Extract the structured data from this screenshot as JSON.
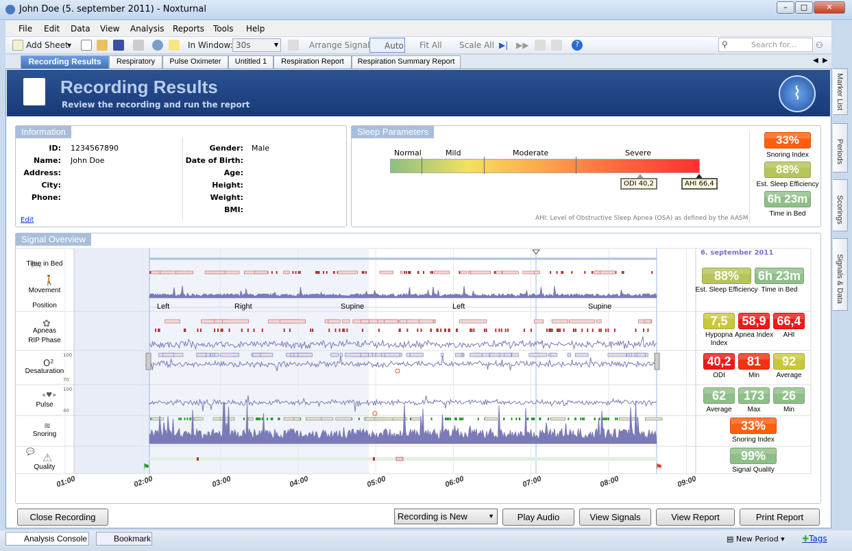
{
  "window": {
    "title": "John Doe (5. september 2011)  - Noxturnal"
  },
  "menu": [
    "File",
    "Edit",
    "Data",
    "View",
    "Analysis",
    "Reports",
    "Tools",
    "Help"
  ],
  "toolbar": {
    "add_sheet": "Add Sheet",
    "in_window_label": "In Window:",
    "in_window_value": "30s",
    "arrange_signals": "Arrange Signals",
    "auto": "Auto",
    "fit_all": "Fit All",
    "scale_all": "Scale All",
    "search_placeholder": "Search for..."
  },
  "tabs": [
    "Recording Results",
    "Respiratory",
    "Pulse Oximeter",
    "Untitled 1",
    "Respiration Report",
    "Respiration Summary Report"
  ],
  "side_tabs": [
    "Marker List",
    "Periods",
    "Scorings",
    "Signals & Data"
  ],
  "banner": {
    "title": "Recording Results",
    "subtitle": "Review the recording and run the report"
  },
  "information": {
    "title": "Information",
    "fields_left": [
      {
        "label": "ID:",
        "value": "1234567890"
      },
      {
        "label": "Name:",
        "value": "John Doe"
      },
      {
        "label": "Address:",
        "value": ""
      },
      {
        "label": "City:",
        "value": ""
      },
      {
        "label": "Phone:",
        "value": ""
      }
    ],
    "fields_right": [
      {
        "label": "Gender:",
        "value": "Male"
      },
      {
        "label": "Date of Birth:",
        "value": ""
      },
      {
        "label": "Age:",
        "value": ""
      },
      {
        "label": "Height:",
        "value": ""
      },
      {
        "label": "Weight:",
        "value": ""
      },
      {
        "label": "BMI:",
        "value": ""
      }
    ],
    "edit": "Edit"
  },
  "sleep_parameters": {
    "title": "Sleep Parameters",
    "scale": [
      "Normal",
      "Mild",
      "Moderate",
      "Severe"
    ],
    "markers": [
      {
        "label": "ODI 40,2",
        "value": 40.2
      },
      {
        "label": "AHI 66,4",
        "value": 66.4
      }
    ],
    "note": "AHI: Level of Obstructive Sleep Apnea (OSA) as defined by the AASM",
    "badges": [
      {
        "value": "33%",
        "caption": "Snoring Index",
        "color": "#ff6010"
      },
      {
        "value": "88%",
        "caption": "Est. Sleep Efficiency",
        "color": "#b8c45a"
      },
      {
        "value": "6h 23m",
        "caption": "Time in Bed",
        "color": "#8fbf88"
      }
    ]
  },
  "signal_overview": {
    "title": "Signal Overview",
    "date": "6. september 2011",
    "rows": [
      {
        "labels": [
          "Time in Bed",
          "Movement",
          "Position"
        ]
      },
      {
        "labels": [
          "Apneas",
          "RIP Phase"
        ]
      },
      {
        "labels": [
          "Desaturation"
        ],
        "axis": [
          "100",
          "70"
        ]
      },
      {
        "labels": [
          "Pulse"
        ],
        "axis": [
          "100",
          "40"
        ]
      },
      {
        "labels": [
          "Snoring"
        ]
      },
      {
        "labels": [
          "Quality"
        ]
      }
    ],
    "positions": [
      "Left",
      "Right",
      "Supine",
      "Left",
      "Supine"
    ],
    "stats": [
      [
        {
          "value": "88%",
          "caption": "Est. Sleep Efficiency",
          "color": "#b8c45a"
        },
        {
          "value": "6h 23m",
          "caption": "Time in Bed",
          "color": "#8fbf88"
        }
      ],
      [
        {
          "value": "7,5",
          "caption": "Hypopna Index",
          "color": "#c9c83a"
        },
        {
          "value": "58,9",
          "caption": "Apnea Index",
          "color": "#f01818"
        },
        {
          "value": "66,4",
          "caption": "AHI",
          "color": "#f01818"
        }
      ],
      [
        {
          "value": "40,2",
          "caption": "ODI",
          "color": "#f01818"
        },
        {
          "value": "81",
          "caption": "Min",
          "color": "#f43010"
        },
        {
          "value": "92",
          "caption": "Average",
          "color": "#c9c83a"
        }
      ],
      [
        {
          "value": "62",
          "caption": "Average",
          "color": "#8fbf88"
        },
        {
          "value": "173",
          "caption": "Max",
          "color": "#8fbf88"
        },
        {
          "value": "26",
          "caption": "Min",
          "color": "#8fbf88"
        }
      ],
      [
        {
          "value": "33%",
          "caption": "Snoring Index",
          "color": "#ff6010"
        }
      ],
      [
        {
          "value": "99%",
          "caption": "Signal Quality",
          "color": "#8fbf88"
        }
      ]
    ],
    "time_ticks": [
      "01:00",
      "02:00",
      "03:00",
      "04:00",
      "05:00",
      "06:00",
      "07:00",
      "08:00",
      "09:00"
    ]
  },
  "buttons": {
    "close": "Close Recording",
    "status": "Recording is New",
    "play": "Play Audio",
    "signals": "View Signals",
    "report": "View Report",
    "print": "Print Report"
  },
  "statusbar": {
    "console": "Analysis Console",
    "bookmark": "Bookmark",
    "new_period": "New Period",
    "tags": "Tags"
  }
}
